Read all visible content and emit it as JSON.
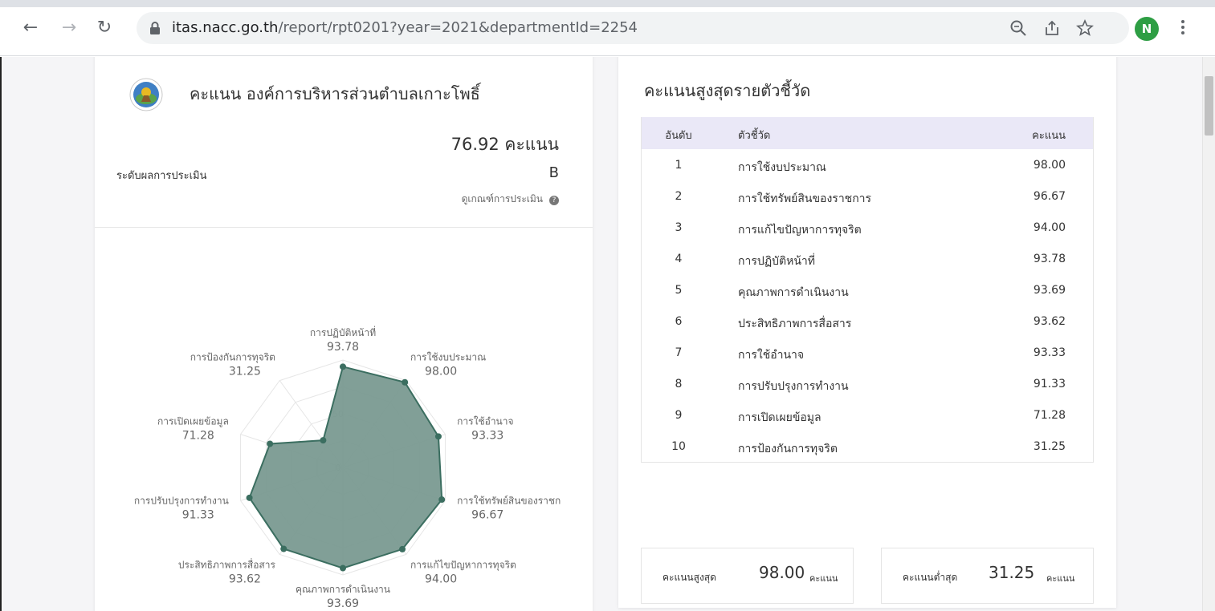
{
  "browser": {
    "url_domain": "itas.nacc.go.th",
    "url_path": "/report/rpt0201?year=2021&departmentId=2254",
    "avatar_letter": "N",
    "icons": [
      "back-icon",
      "forward-icon",
      "reload-icon",
      "lock-icon",
      "zoom-icon",
      "share-icon",
      "star-icon",
      "menu-icon"
    ]
  },
  "summary": {
    "title": "คะแนน องค์การบริหารส่วนตำบลเกาะโพธิ์",
    "score": "76.92 คะแนน",
    "grade_label": "ระดับผลการประเมิน",
    "grade": "B",
    "criteria_link": "ดูเกณฑ์การประเมิน"
  },
  "chart_data": {
    "type": "radar",
    "rmax": 100,
    "tick_labels": [
      "0",
      "50"
    ],
    "series": [
      {
        "color": "#3b6e60",
        "fill": "#7a9a91",
        "points": [
          {
            "label": "การปฏิบัติหน้าที่",
            "value": "93.78"
          },
          {
            "label": "การใช้งบประมาณ",
            "value": "98.00"
          },
          {
            "label": "การใช้อำนาจ",
            "value": "93.33"
          },
          {
            "label": "การใช้ทรัพย์สินของราชก",
            "value": "96.67"
          },
          {
            "label": "การแก้ไขปัญหาการทุจริต",
            "value": "94.00"
          },
          {
            "label": "คุณภาพการดำเนินงาน",
            "value": "93.69"
          },
          {
            "label": "ประสิทธิภาพการสื่อสาร",
            "value": "93.62"
          },
          {
            "label": "การปรับปรุงการทำงาน",
            "value": "91.33"
          },
          {
            "label": "การเปิดเผยข้อมูล",
            "value": "71.28"
          },
          {
            "label": "การป้องกันการทุจริต",
            "value": "31.25"
          }
        ]
      }
    ]
  },
  "ranking": {
    "title": "คะแนนสูงสุดรายตัวชี้วัด",
    "headers": {
      "rank": "อันดับ",
      "name": "ตัวชี้วัด",
      "score": "คะแนน"
    },
    "rows": [
      {
        "rank": "1",
        "name": "การใช้งบประมาณ",
        "score": "98.00"
      },
      {
        "rank": "2",
        "name": "การใช้ทรัพย์สินของราชการ",
        "score": "96.67"
      },
      {
        "rank": "3",
        "name": "การแก้ไขปัญหาการทุจริต",
        "score": "94.00"
      },
      {
        "rank": "4",
        "name": "การปฏิบัติหน้าที่",
        "score": "93.78"
      },
      {
        "rank": "5",
        "name": "คุณภาพการดำเนินงาน",
        "score": "93.69"
      },
      {
        "rank": "6",
        "name": "ประสิทธิภาพการสื่อสาร",
        "score": "93.62"
      },
      {
        "rank": "7",
        "name": "การใช้อำนาจ",
        "score": "93.33"
      },
      {
        "rank": "8",
        "name": "การปรับปรุงการทำงาน",
        "score": "91.33"
      },
      {
        "rank": "9",
        "name": "การเปิดเผยข้อมูล",
        "score": "71.28"
      },
      {
        "rank": "10",
        "name": "การป้องกันการทุจริต",
        "score": "31.25"
      }
    ]
  },
  "extremes": {
    "max_label": "คะแนนสูงสุด",
    "max_value": "98.00",
    "max_unit": "คะแนน",
    "min_label": "คะแนนต่ำสุด",
    "min_value": "31.25",
    "min_unit": "คะแนน"
  }
}
